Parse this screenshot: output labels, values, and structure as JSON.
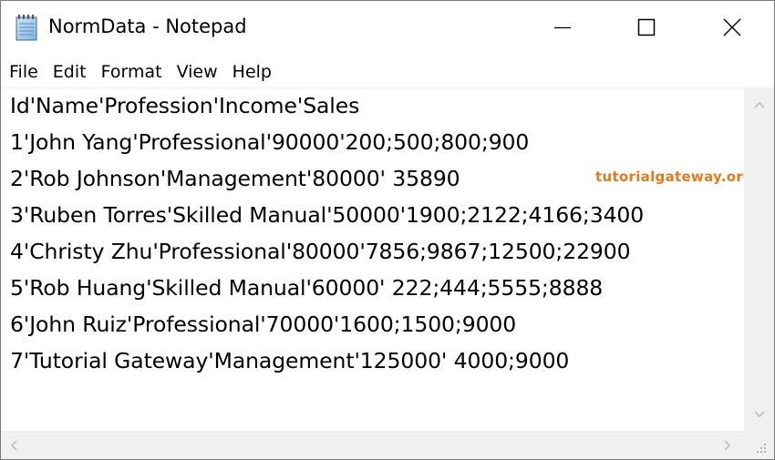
{
  "window": {
    "title": "NormData - Notepad",
    "icon": "notepad-icon"
  },
  "caption_buttons": {
    "minimize_icon": "minimize-icon",
    "maximize_icon": "maximize-icon",
    "close_icon": "close-icon"
  },
  "menu": {
    "items": [
      "File",
      "Edit",
      "Format",
      "View",
      "Help"
    ]
  },
  "editor": {
    "lines": [
      "Id'Name'Profession'Income'Sales",
      "1'John Yang'Professional'90000'200;500;800;900",
      "2'Rob Johnson'Management'80000' 35890",
      "3'Ruben Torres'Skilled Manual'50000'1900;2122;4166;3400",
      "4'Christy Zhu'Professional'80000'7856;9867;12500;22900",
      "5'Rob Huang'Skilled Manual'60000' 222;444;5555;8888",
      "6'John Ruiz'Professional'70000'1600;1500;9000",
      "7'Tutorial Gateway'Management'125000' 4000;9000"
    ]
  },
  "watermark": {
    "text": "tutorialgateway.org",
    "color": "#e07a1c"
  },
  "scrollbars": {
    "up_icon": "chevron-up-icon",
    "down_icon": "chevron-down-icon",
    "left_icon": "chevron-left-icon",
    "right_icon": "chevron-right-icon",
    "grip_icon": "resize-grip-icon"
  }
}
